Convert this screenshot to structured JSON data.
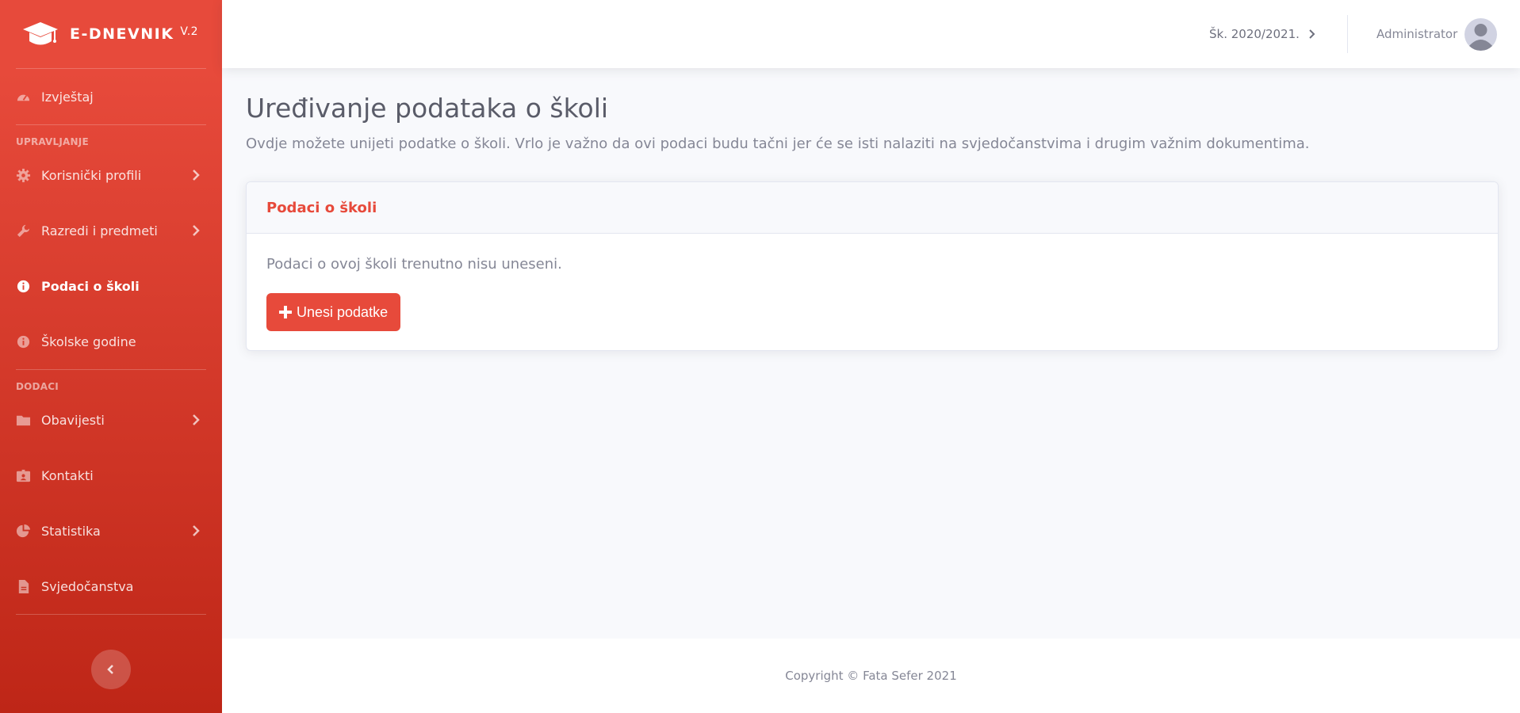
{
  "brand": {
    "name": "E-DNEVNIK",
    "version": "V.2",
    "icon": "graduation-cap-icon"
  },
  "sidebar": {
    "items": [
      {
        "label": "Izvještaj",
        "icon": "tachometer-icon"
      },
      {
        "label": "Korisnički profili",
        "icon": "gear-icon"
      },
      {
        "label": "Razredi i predmeti",
        "icon": "wrench-icon"
      },
      {
        "label": "Podaci o školi",
        "icon": "info-circle-icon",
        "active": true
      },
      {
        "label": "Školske godine",
        "icon": "info-circle-icon"
      },
      {
        "label": "Obavijesti",
        "icon": "folder-icon"
      },
      {
        "label": "Kontakti",
        "icon": "id-card-icon"
      },
      {
        "label": "Statistika",
        "icon": "pie-chart-icon"
      },
      {
        "label": "Svjedočanstva",
        "icon": "file-icon"
      }
    ],
    "headings": {
      "management": "UPRAVLJANJE",
      "addons": "DODACI"
    }
  },
  "topbar": {
    "school_year": "Šk. 2020/2021.",
    "user_name": "Administrator"
  },
  "main": {
    "title": "Uređivanje podataka o školi",
    "description": "Ovdje možete unijeti podatke o školi. Vrlo je važno da ovi podaci budu tačni jer će se isti nalaziti na svjedočanstvima i drugim važnim dokumentima.",
    "card": {
      "title": "Podaci o školi",
      "text": "Podaci o ovoj školi trenutno nisu uneseni.",
      "button_label": "Unesi podatke"
    }
  },
  "footer": {
    "copyright": "Copyright © Fata Sefer 2021"
  },
  "colors": {
    "primary": "#e74a3b",
    "primary_dark": "#be2617",
    "background": "#f8f9fc",
    "text": "#858796",
    "heading": "#5a5c69"
  }
}
